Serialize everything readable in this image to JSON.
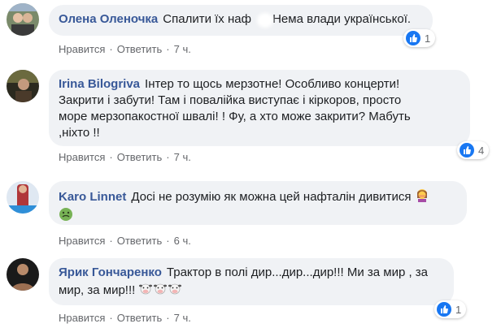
{
  "ui": {
    "like_label": "Нравится",
    "reply_label": "Ответить",
    "separator": "·",
    "icons": {
      "like": "like-icon",
      "avatar": "avatar-photo"
    },
    "colors": {
      "author": "#385898",
      "bubble": "#f0f2f5",
      "like": "#1877f2",
      "meta": "#65676b"
    }
  },
  "comments": [
    {
      "author": "Олена Оленочка",
      "text_part1": "Спалити їх наф",
      "text_part2": " Нема влади української.",
      "time": "7 ч.",
      "reactions": "1"
    },
    {
      "author": "Irina Bilogriva",
      "line1": "Інтер то щось мерзотне! Особливо концерти!",
      "line2": "Закрити і забути! Там і повалійка виступає і кіркоров, просто",
      "line3": "море мерзопакостної швалі! ! Фу, а хто може закрити? Мабуть",
      "line4": ",ніхто !!",
      "time": "7 ч.",
      "reactions": "4"
    },
    {
      "author": "Karo Linnet",
      "text": "Досі не розумію як можна цей нафталін дивитися",
      "emojis": [
        "woman-facepalming-emoji",
        "nauseated-face-emoji"
      ],
      "time": "6 ч."
    },
    {
      "author": "Ярик Гончаренко",
      "line1": "Трактор в полі дир...дир...дир!!! Ми за мир , за",
      "line2": "мир, за мир!!!",
      "emojis": [
        "cow-emoji",
        "cow-emoji",
        "cow-emoji"
      ],
      "time": "7 ч.",
      "reactions": "1"
    }
  ]
}
